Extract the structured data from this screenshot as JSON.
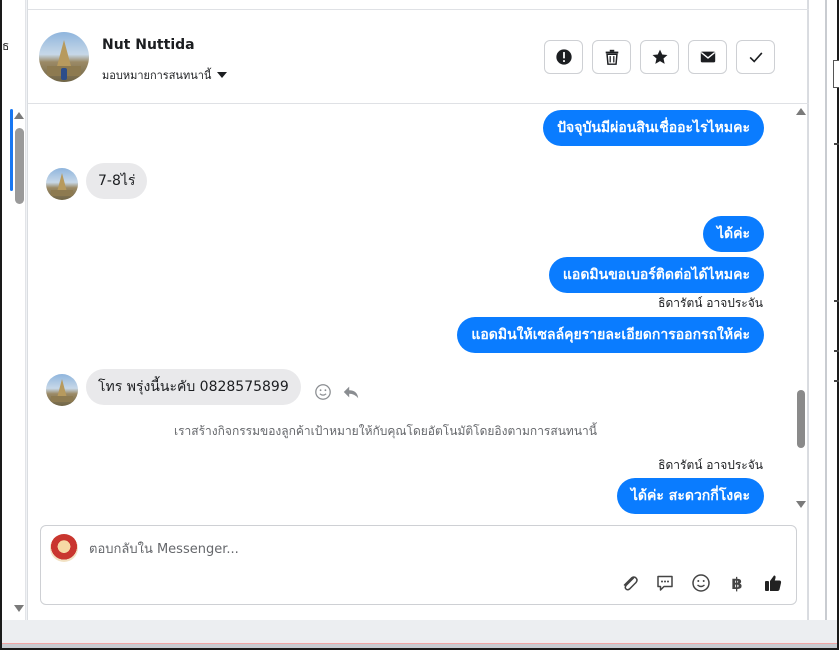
{
  "header": {
    "contact_name": "Nut Nuttida",
    "assign_label": "มอบหมายการสนทนานี้",
    "actions": [
      {
        "name": "report-spam",
        "icon": "alert-circle-icon"
      },
      {
        "name": "delete",
        "icon": "trash-icon"
      },
      {
        "name": "star",
        "icon": "star-icon"
      },
      {
        "name": "mark-unread",
        "icon": "envelope-icon"
      },
      {
        "name": "mark-done",
        "icon": "check-icon"
      }
    ]
  },
  "messages": [
    {
      "direction": "out",
      "text": "ปัจจุบันมีผ่อนสินเชื่ออะไรไหมคะ"
    },
    {
      "direction": "in",
      "text": "7-8ไร่"
    },
    {
      "direction": "out",
      "text": "ได้ค่ะ"
    },
    {
      "direction": "out",
      "text": "แอดมินขอเบอร์ติดต่อได้ไหมคะ"
    },
    {
      "direction": "label",
      "text": "ธิดารัตน์ อาจประจัน"
    },
    {
      "direction": "out",
      "text": "แอดมินให้เซลล์คุยรายละเอียดการออกรถให้ค่ะ"
    },
    {
      "direction": "in",
      "text": "โทร พรุ่งนี้นะคับ 0828575899"
    },
    {
      "direction": "system",
      "text": "เราสร้างกิจกรรมของลูกค้าเป้าหมายให้กับคุณโดยอัตโนมัติโดยอิงตามการสนทนานี้"
    },
    {
      "direction": "label",
      "text": "ธิดารัตน์ อาจประจัน"
    },
    {
      "direction": "out",
      "text": "ได้ค่ะ สะดวกกี่โงคะ"
    }
  ],
  "composer": {
    "placeholder": "ตอบกลับใน Messenger...",
    "tools": [
      "paperclip-icon",
      "speech-bubble-icon",
      "smiley-icon",
      "baht-icon",
      "thumbs-up-icon"
    ],
    "baht_symbol": "฿"
  },
  "colors": {
    "accent": "#0a7cff",
    "incoming_bubble": "#e9e9eb"
  },
  "left_strip": {
    "glyph": "ธ"
  }
}
